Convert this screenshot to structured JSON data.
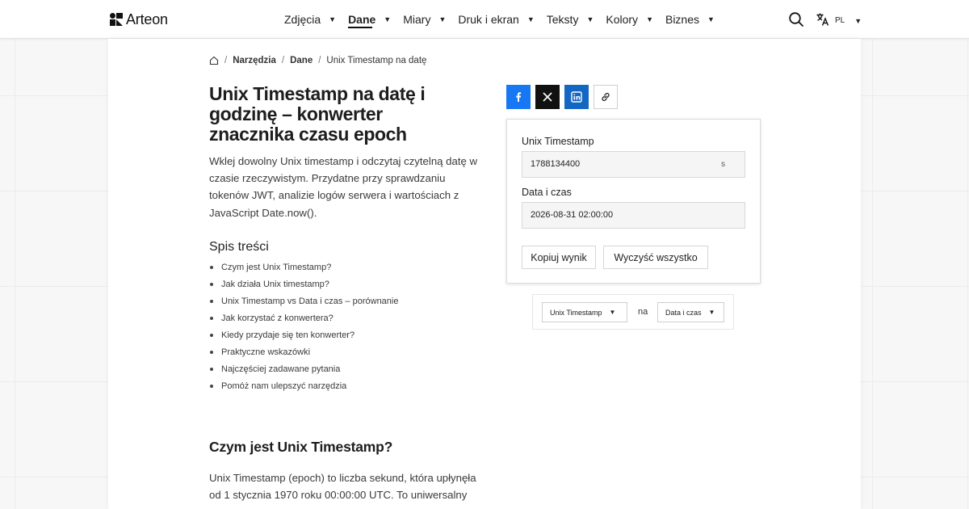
{
  "brand": {
    "name": "Arteon"
  },
  "nav": {
    "items": [
      {
        "label": "Zdjęcia",
        "active": false
      },
      {
        "label": "Dane",
        "active": true
      },
      {
        "label": "Miary",
        "active": false
      },
      {
        "label": "Druk i ekran",
        "active": false
      },
      {
        "label": "Teksty",
        "active": false
      },
      {
        "label": "Kolory",
        "active": false
      },
      {
        "label": "Biznes",
        "active": false
      }
    ],
    "language": "PL",
    "search_icon": "search-icon",
    "language_icon": "translate-icon"
  },
  "breadcrumb": {
    "home_icon": "home-icon",
    "items": [
      "Narzędzia",
      "Dane",
      "Unix Timestamp na datę"
    ]
  },
  "page": {
    "title": "Unix Timestamp na datę i godzinę – konwerter znacznika czasu epoch",
    "intro": "Wklej dowolny Unix timestamp i odczytaj czytelną datę w czasie rzeczywistym. Przydatne przy sprawdzaniu tokenów JWT, analizie logów serwera i wartościach z JavaScript Date.now().",
    "toc_title": "Spis treści",
    "toc": [
      "Czym jest Unix Timestamp?",
      "Jak działa Unix timestamp?",
      "Unix Timestamp vs Data i czas – porównanie",
      "Jak korzystać z konwertera?",
      "Kiedy przydaje się ten konwerter?",
      "Praktyczne wskazówki",
      "Najczęściej zadawane pytania",
      "Pomóż nam ulepszyć narzędzia"
    ],
    "section_title": "Czym jest Unix Timestamp?",
    "section_body": "Unix Timestamp (epoch) to liczba sekund, która upłynęła od 1 stycznia 1970 roku 00:00:00 UTC. To uniwersalny"
  },
  "share": {
    "facebook_icon": "facebook-icon",
    "x_icon": "x-icon",
    "linkedin_icon": "linkedin-icon",
    "link_icon": "link-icon",
    "colors": {
      "facebook": "#1877f2",
      "x": "#111111",
      "linkedin": "#1466c3"
    }
  },
  "converter": {
    "timestamp_label": "Unix Timestamp",
    "timestamp_value": "1788134400",
    "timestamp_unit": "s",
    "datetime_label": "Data i czas",
    "datetime_value": "2026-08-31 02:00:00",
    "copy_button": "Kopiuj wynik",
    "clear_button": "Wyczyść wszystko"
  },
  "mode": {
    "from": "Unix Timestamp",
    "connector": "na",
    "to": "Data i czas"
  }
}
